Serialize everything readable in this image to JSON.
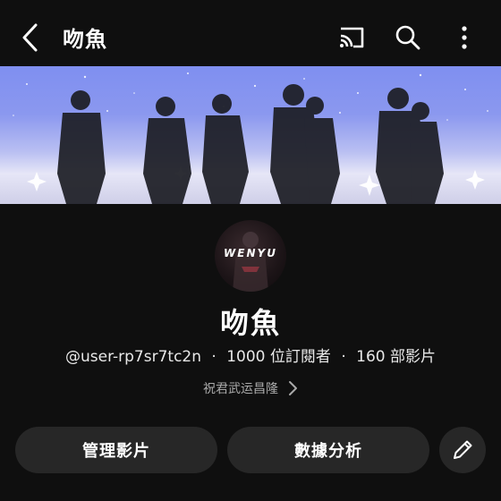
{
  "header": {
    "title": "吻魚",
    "icons": [
      "back-arrow-icon",
      "cast-icon",
      "search-icon",
      "more-vert-icon"
    ]
  },
  "channel": {
    "avatar_text": "WENYU",
    "name": "吻魚",
    "handle": "@user-rp7sr7tc2n",
    "subscribers": "1000 位訂閱者",
    "videos": "160 部影片",
    "separator": "·",
    "description": "祝君武运昌隆"
  },
  "actions": {
    "manage_videos": "管理影片",
    "analytics": "數據分析"
  },
  "colors": {
    "background": "#0f0f0f",
    "button_bg": "#272727",
    "secondary_text": "#aaaaaa"
  }
}
